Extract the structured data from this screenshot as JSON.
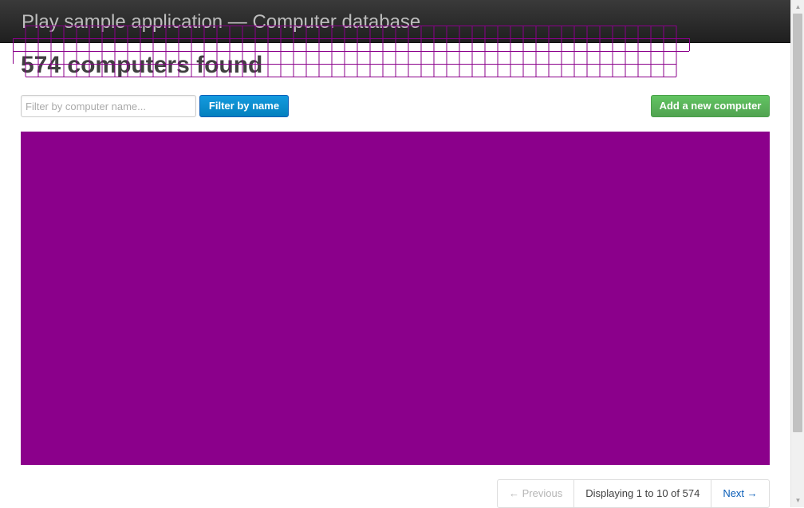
{
  "header": {
    "title": "Play sample application — Computer database"
  },
  "main": {
    "heading": "574 computers found",
    "search": {
      "placeholder": "Filter by computer name...",
      "value": ""
    },
    "filter_button_label": "Filter by name",
    "add_button_label": "Add a new computer"
  },
  "pagination": {
    "previous_label": "← Previous",
    "current_label": "Displaying 1 to 10 of 574",
    "next_label": "Next →"
  },
  "colors": {
    "overlay": "#8b008b",
    "primary_button": "#0480be",
    "success_button": "#51a351"
  }
}
